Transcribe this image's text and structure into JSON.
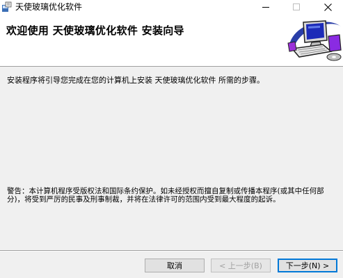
{
  "window": {
    "title": "天使玻璃优化软件",
    "icon": "installer-icon",
    "controls": [
      "minimize-icon",
      "maximize-icon",
      "close-icon"
    ]
  },
  "header": {
    "title": "欢迎使用 天使玻璃优化软件 安装向导",
    "banner_image": "computer-setup-icon"
  },
  "body": {
    "intro": "安装程序将引导您完成在您的计算机上安装 天使玻璃优化软件 所需的步骤。",
    "warning": "警告：本计算机程序受版权法和国际条约保护。如未经授权而擅自复制或传播本程序(或其中任何部分)，将受到严厉的民事及刑事制裁，并将在法律许可的范围内受到最大程度的起诉。"
  },
  "buttons": {
    "cancel": "取消",
    "back": "< 上一步(B)",
    "next": "下一步(N) >"
  },
  "colors": {
    "dialog_bg": "#f0f0f0",
    "header_bg": "#ffffff",
    "default_button_border": "#0078d7"
  }
}
